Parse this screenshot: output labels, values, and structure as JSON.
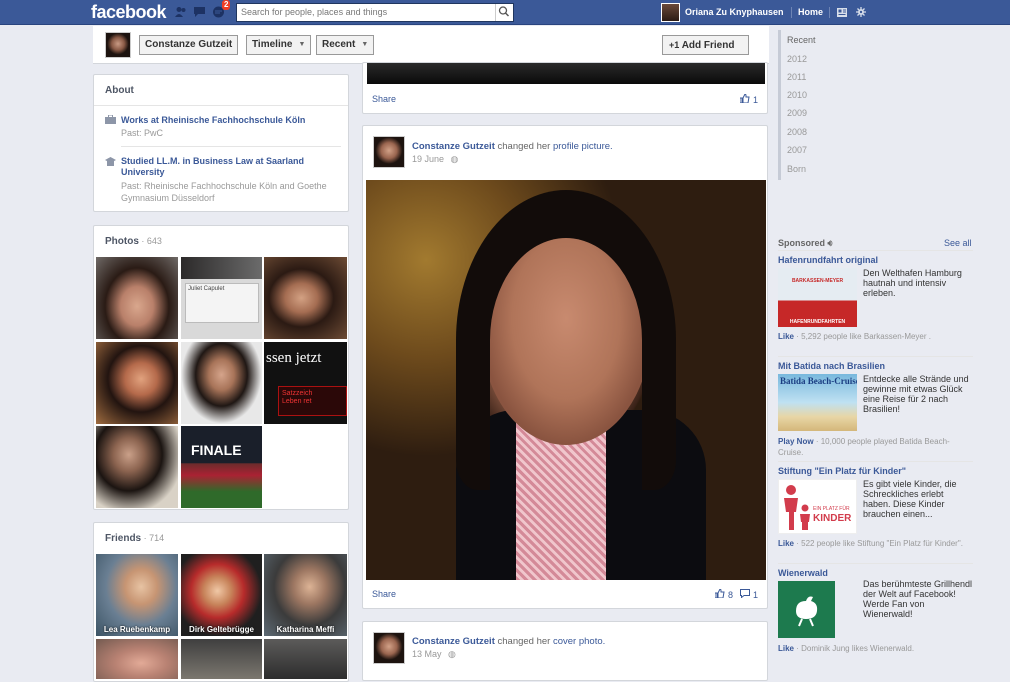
{
  "topbar": {
    "logo": "facebook",
    "notification_count": "2",
    "search_placeholder": "Search for people, places and things",
    "user_name": "Oriana Zu Knyphausen",
    "home_label": "Home"
  },
  "profile_nav": {
    "name": "Constanze Gutzeit",
    "timeline_label": "Timeline",
    "recent_label": "Recent",
    "add_friend_label": "Add Friend"
  },
  "about": {
    "title": "About",
    "work_main": "Works at Rheinische Fachhochschule Köln",
    "work_past": "Past: PwC",
    "study_main": "Studied LL.M. in Business Law at Saarland University",
    "study_past": "Past: Rheinische Fachhochschule Köln and Goethe Gymnasium Düsseldorf"
  },
  "photos": {
    "title": "Photos",
    "count": "· 643",
    "tile_texts": [
      "ssen jetzt",
      "Satzzeich",
      "Leben ret",
      "FINALE",
      "Juliet Capulet"
    ]
  },
  "friends": {
    "title": "Friends",
    "count": "· 714",
    "items": [
      "Lea Ruebenkamp",
      "Dirk Geltebrügge",
      "Katharina Meffi"
    ]
  },
  "feed": {
    "share_label": "Share",
    "post0_likes": "1",
    "post1": {
      "author": "Constanze Gutzeit",
      "action": "changed her",
      "object": "profile picture.",
      "date": "19 June",
      "likes": "8",
      "comments": "1"
    },
    "post2": {
      "author": "Constanze Gutzeit",
      "action": "changed her",
      "object": "cover photo.",
      "date": "13 May"
    }
  },
  "timeline_years": [
    "Recent",
    "2012",
    "2011",
    "2010",
    "2009",
    "2008",
    "2007",
    "Born"
  ],
  "sponsored": {
    "title": "Sponsored",
    "see_all": "See all",
    "ads": [
      {
        "title": "Hafenrundfahrt original",
        "text": "Den Welthafen Hamburg hautnah und intensiv erleben.",
        "image_text": "BARKASSEN-MEYER",
        "image_sub": "HAFENRUNDFAHRTEN",
        "action": "Like",
        "social": "· 5,292 people like Barkassen-Meyer ."
      },
      {
        "title": "Mit Batida nach Brasilien",
        "text": "Entdecke alle Strände und gewinne mit etwas Glück eine Reise für 2 nach Brasilien!",
        "image_text": "Batida Beach-Cruise",
        "action": "Play Now",
        "social": "· 10,000 people played Batida Beach-Cruise."
      },
      {
        "title": "Stiftung \"Ein Platz für Kinder\"",
        "text": "Es gibt viele Kinder, die Schreckliches erlebt haben. Diese Kinder brauchen einen...",
        "image_text": "EIN PLATZ FÜR",
        "image_sub": "KINDER",
        "action": "Like",
        "social": "· 522 people like Stiftung \"Ein Platz für Kinder\"."
      },
      {
        "title": "Wienerwald",
        "text": "Das berühmteste Grillhendl der Welt auf Facebook! Werde Fan von Wienerwald!",
        "action": "Like",
        "social": "· Dominik Jung likes Wienerwald."
      }
    ]
  },
  "colors": {
    "brand": "#3b5998",
    "page_bg": "#e9ebf2",
    "badge": "#f03d25"
  }
}
